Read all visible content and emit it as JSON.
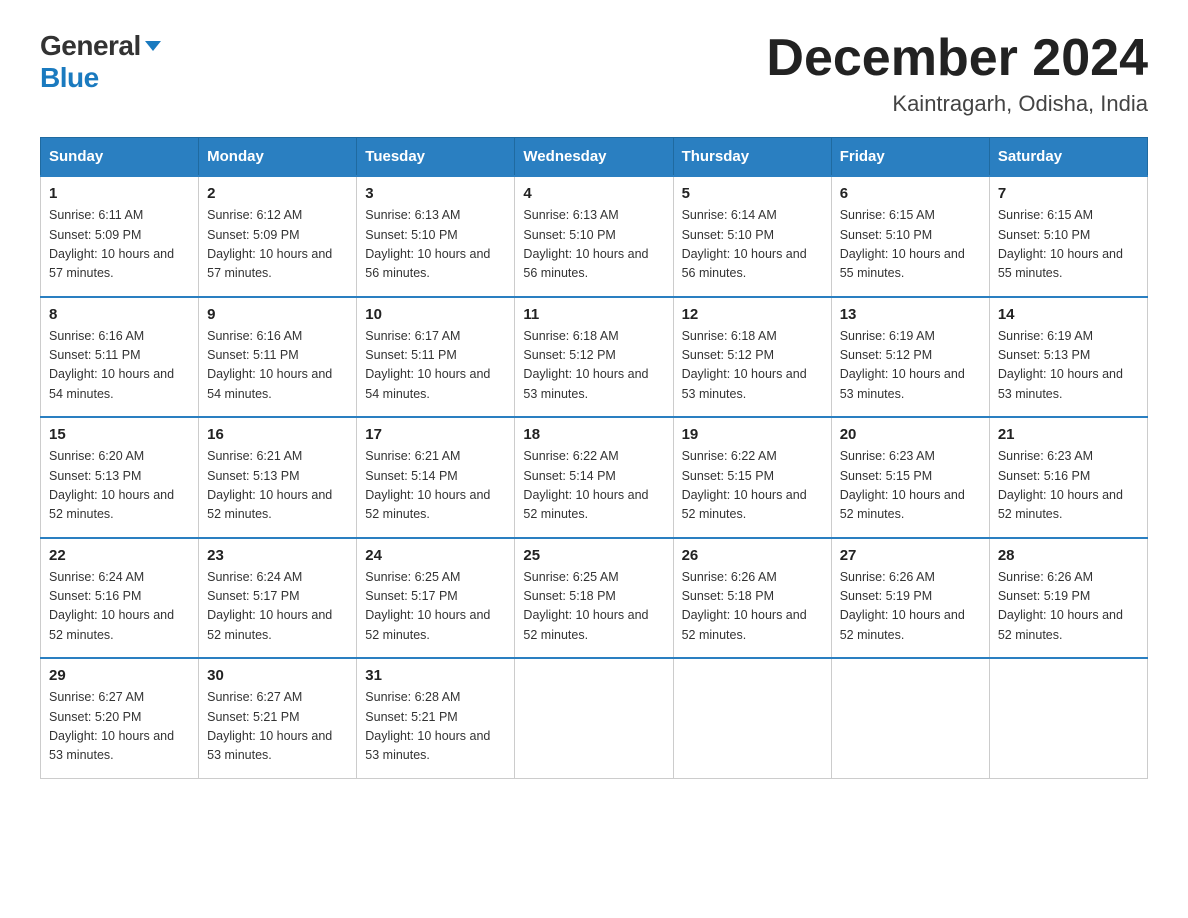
{
  "logo": {
    "general": "General",
    "blue": "Blue"
  },
  "title": "December 2024",
  "subtitle": "Kaintragarh, Odisha, India",
  "header_days": [
    "Sunday",
    "Monday",
    "Tuesday",
    "Wednesday",
    "Thursday",
    "Friday",
    "Saturday"
  ],
  "weeks": [
    [
      {
        "day": "1",
        "sunrise": "Sunrise: 6:11 AM",
        "sunset": "Sunset: 5:09 PM",
        "daylight": "Daylight: 10 hours and 57 minutes."
      },
      {
        "day": "2",
        "sunrise": "Sunrise: 6:12 AM",
        "sunset": "Sunset: 5:09 PM",
        "daylight": "Daylight: 10 hours and 57 minutes."
      },
      {
        "day": "3",
        "sunrise": "Sunrise: 6:13 AM",
        "sunset": "Sunset: 5:10 PM",
        "daylight": "Daylight: 10 hours and 56 minutes."
      },
      {
        "day": "4",
        "sunrise": "Sunrise: 6:13 AM",
        "sunset": "Sunset: 5:10 PM",
        "daylight": "Daylight: 10 hours and 56 minutes."
      },
      {
        "day": "5",
        "sunrise": "Sunrise: 6:14 AM",
        "sunset": "Sunset: 5:10 PM",
        "daylight": "Daylight: 10 hours and 56 minutes."
      },
      {
        "day": "6",
        "sunrise": "Sunrise: 6:15 AM",
        "sunset": "Sunset: 5:10 PM",
        "daylight": "Daylight: 10 hours and 55 minutes."
      },
      {
        "day": "7",
        "sunrise": "Sunrise: 6:15 AM",
        "sunset": "Sunset: 5:10 PM",
        "daylight": "Daylight: 10 hours and 55 minutes."
      }
    ],
    [
      {
        "day": "8",
        "sunrise": "Sunrise: 6:16 AM",
        "sunset": "Sunset: 5:11 PM",
        "daylight": "Daylight: 10 hours and 54 minutes."
      },
      {
        "day": "9",
        "sunrise": "Sunrise: 6:16 AM",
        "sunset": "Sunset: 5:11 PM",
        "daylight": "Daylight: 10 hours and 54 minutes."
      },
      {
        "day": "10",
        "sunrise": "Sunrise: 6:17 AM",
        "sunset": "Sunset: 5:11 PM",
        "daylight": "Daylight: 10 hours and 54 minutes."
      },
      {
        "day": "11",
        "sunrise": "Sunrise: 6:18 AM",
        "sunset": "Sunset: 5:12 PM",
        "daylight": "Daylight: 10 hours and 53 minutes."
      },
      {
        "day": "12",
        "sunrise": "Sunrise: 6:18 AM",
        "sunset": "Sunset: 5:12 PM",
        "daylight": "Daylight: 10 hours and 53 minutes."
      },
      {
        "day": "13",
        "sunrise": "Sunrise: 6:19 AM",
        "sunset": "Sunset: 5:12 PM",
        "daylight": "Daylight: 10 hours and 53 minutes."
      },
      {
        "day": "14",
        "sunrise": "Sunrise: 6:19 AM",
        "sunset": "Sunset: 5:13 PM",
        "daylight": "Daylight: 10 hours and 53 minutes."
      }
    ],
    [
      {
        "day": "15",
        "sunrise": "Sunrise: 6:20 AM",
        "sunset": "Sunset: 5:13 PM",
        "daylight": "Daylight: 10 hours and 52 minutes."
      },
      {
        "day": "16",
        "sunrise": "Sunrise: 6:21 AM",
        "sunset": "Sunset: 5:13 PM",
        "daylight": "Daylight: 10 hours and 52 minutes."
      },
      {
        "day": "17",
        "sunrise": "Sunrise: 6:21 AM",
        "sunset": "Sunset: 5:14 PM",
        "daylight": "Daylight: 10 hours and 52 minutes."
      },
      {
        "day": "18",
        "sunrise": "Sunrise: 6:22 AM",
        "sunset": "Sunset: 5:14 PM",
        "daylight": "Daylight: 10 hours and 52 minutes."
      },
      {
        "day": "19",
        "sunrise": "Sunrise: 6:22 AM",
        "sunset": "Sunset: 5:15 PM",
        "daylight": "Daylight: 10 hours and 52 minutes."
      },
      {
        "day": "20",
        "sunrise": "Sunrise: 6:23 AM",
        "sunset": "Sunset: 5:15 PM",
        "daylight": "Daylight: 10 hours and 52 minutes."
      },
      {
        "day": "21",
        "sunrise": "Sunrise: 6:23 AM",
        "sunset": "Sunset: 5:16 PM",
        "daylight": "Daylight: 10 hours and 52 minutes."
      }
    ],
    [
      {
        "day": "22",
        "sunrise": "Sunrise: 6:24 AM",
        "sunset": "Sunset: 5:16 PM",
        "daylight": "Daylight: 10 hours and 52 minutes."
      },
      {
        "day": "23",
        "sunrise": "Sunrise: 6:24 AM",
        "sunset": "Sunset: 5:17 PM",
        "daylight": "Daylight: 10 hours and 52 minutes."
      },
      {
        "day": "24",
        "sunrise": "Sunrise: 6:25 AM",
        "sunset": "Sunset: 5:17 PM",
        "daylight": "Daylight: 10 hours and 52 minutes."
      },
      {
        "day": "25",
        "sunrise": "Sunrise: 6:25 AM",
        "sunset": "Sunset: 5:18 PM",
        "daylight": "Daylight: 10 hours and 52 minutes."
      },
      {
        "day": "26",
        "sunrise": "Sunrise: 6:26 AM",
        "sunset": "Sunset: 5:18 PM",
        "daylight": "Daylight: 10 hours and 52 minutes."
      },
      {
        "day": "27",
        "sunrise": "Sunrise: 6:26 AM",
        "sunset": "Sunset: 5:19 PM",
        "daylight": "Daylight: 10 hours and 52 minutes."
      },
      {
        "day": "28",
        "sunrise": "Sunrise: 6:26 AM",
        "sunset": "Sunset: 5:19 PM",
        "daylight": "Daylight: 10 hours and 52 minutes."
      }
    ],
    [
      {
        "day": "29",
        "sunrise": "Sunrise: 6:27 AM",
        "sunset": "Sunset: 5:20 PM",
        "daylight": "Daylight: 10 hours and 53 minutes."
      },
      {
        "day": "30",
        "sunrise": "Sunrise: 6:27 AM",
        "sunset": "Sunset: 5:21 PM",
        "daylight": "Daylight: 10 hours and 53 minutes."
      },
      {
        "day": "31",
        "sunrise": "Sunrise: 6:28 AM",
        "sunset": "Sunset: 5:21 PM",
        "daylight": "Daylight: 10 hours and 53 minutes."
      },
      null,
      null,
      null,
      null
    ]
  ]
}
